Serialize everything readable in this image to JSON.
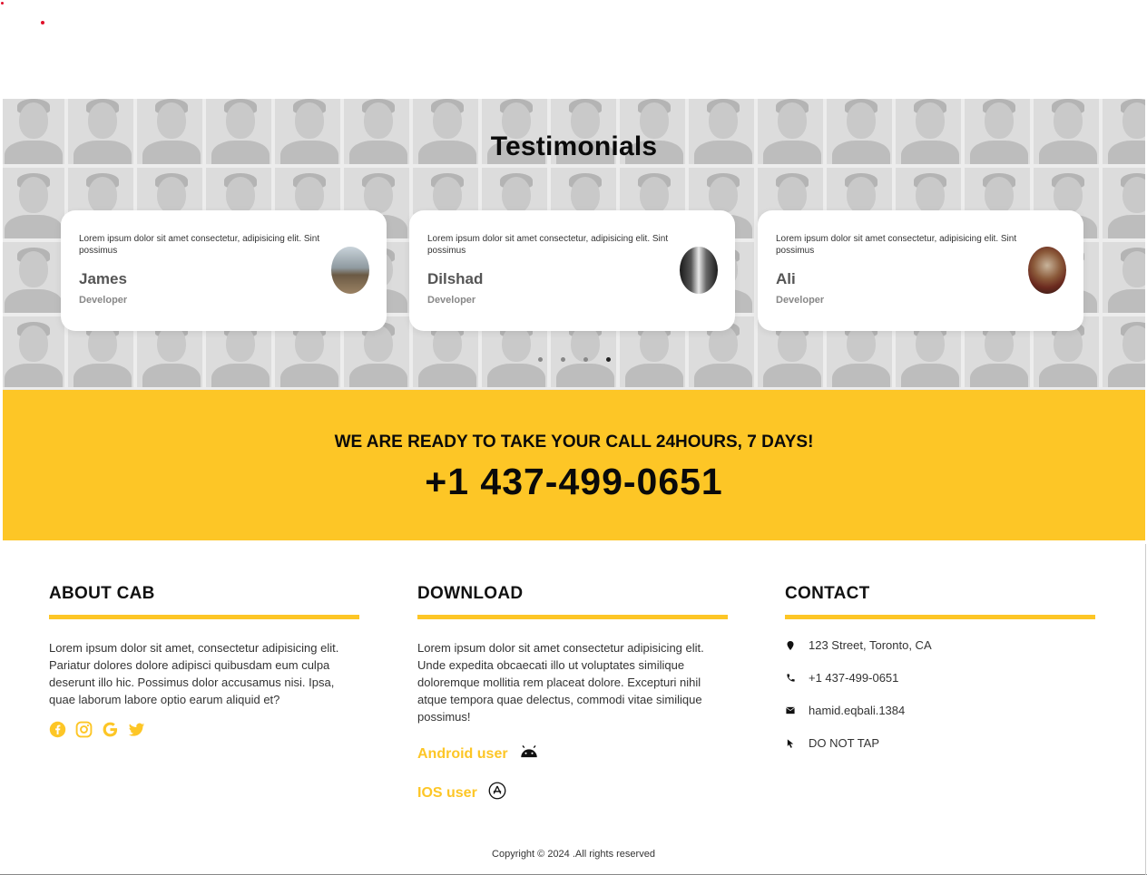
{
  "testimonials": {
    "title": "Testimonials",
    "cards": [
      {
        "quote": "Lorem ipsum dolor sit amet consectetur, adipisicing elit. Sint possimus",
        "name": "James",
        "role": "Developer"
      },
      {
        "quote": "Lorem ipsum dolor sit amet consectetur, adipisicing elit. Sint possimus",
        "name": "Dilshad",
        "role": "Developer"
      },
      {
        "quote": "Lorem ipsum dolor sit amet consectetur, adipisicing elit. Sint possimus",
        "name": "Ali",
        "role": "Developer"
      }
    ],
    "active_dot": 4,
    "dot_count": 4
  },
  "call": {
    "tagline": "WE ARE READY TO TAKE YOUR CALL 24HOURS, 7 DAYS!",
    "phone": "+1 437-499-0651"
  },
  "footer": {
    "about": {
      "title": "ABOUT CAB",
      "text": "Lorem ipsum dolor sit amet, consectetur adipisicing elit. Pariatur dolores dolore adipisci quibusdam eum culpa deserunt illo hic. Possimus dolor accusamus nisi. Ipsa, quae laborum labore optio earum aliquid et?",
      "social": [
        "facebook-icon",
        "instagram-icon",
        "google-icon",
        "twitter-icon"
      ]
    },
    "download": {
      "title": "DOWNLOAD",
      "text": "Lorem ipsum dolor sit amet consectetur adipisicing elit. Unde expedita obcaecati illo ut voluptates similique doloremque mollitia rem placeat dolore. Excepturi nihil atque tempora quae delectus, commodi vitae similique possimus!",
      "android_label": "Android user",
      "ios_label": "IOS user"
    },
    "contact": {
      "title": "CONTACT",
      "address": "123 Street, Toronto, CA",
      "phone": "+1 437-499-0651",
      "email": "hamid.eqbali.1384",
      "tap": "DO NOT TAP"
    },
    "copyright": "Copyright © 2024 .All rights reserved"
  },
  "colors": {
    "accent": "#fdc626",
    "text": "#111111"
  }
}
